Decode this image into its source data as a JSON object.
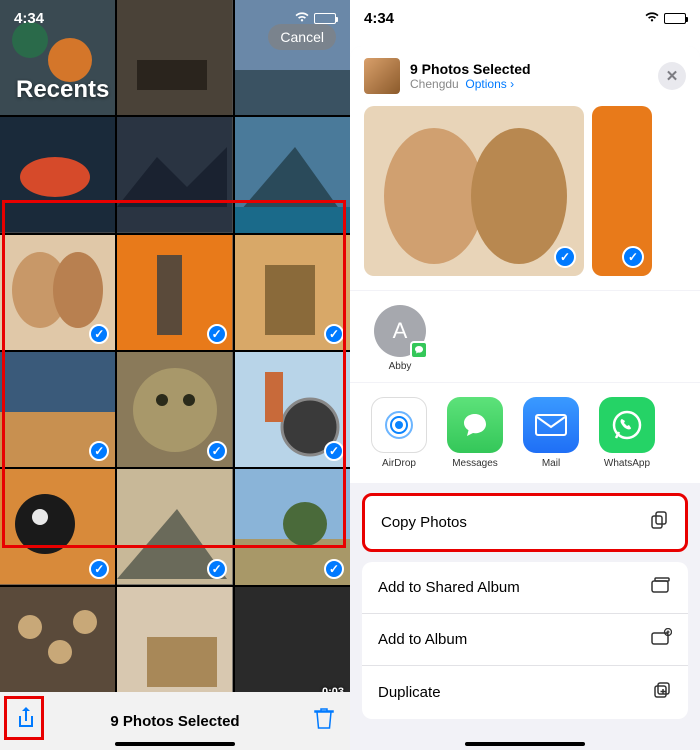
{
  "status": {
    "time": "4:34"
  },
  "left": {
    "album_label": "Recents",
    "cancel": "Cancel",
    "selected_count_label": "9 Photos Selected",
    "video_duration": "0:03"
  },
  "right": {
    "header": {
      "title": "9 Photos Selected",
      "location": "Chengdu",
      "options": "Options",
      "chevron": "›"
    },
    "contacts": [
      {
        "initial": "A",
        "name": "Abby"
      }
    ],
    "apps": [
      {
        "name": "AirDrop",
        "color": "#ffffff",
        "ring": "#0a84ff"
      },
      {
        "name": "Messages",
        "color": "#34c759"
      },
      {
        "name": "Mail",
        "color": "#1f6ff6"
      },
      {
        "name": "WhatsApp",
        "color": "#25d366"
      }
    ],
    "actions": {
      "copy": "Copy Photos",
      "shared_album": "Add to Shared Album",
      "add_album": "Add to Album",
      "duplicate": "Duplicate"
    }
  }
}
